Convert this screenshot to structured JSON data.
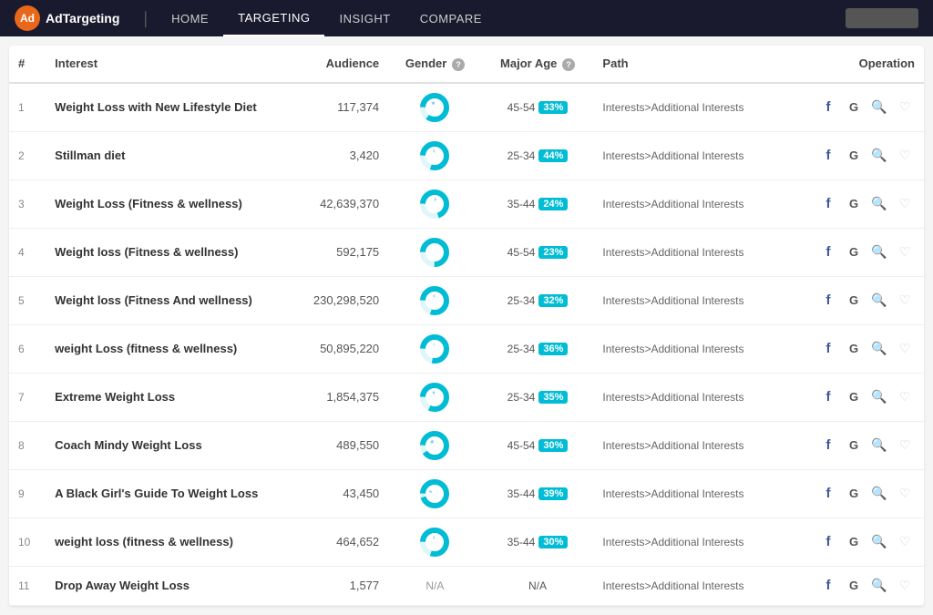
{
  "nav": {
    "logo_icon": "Ad",
    "logo_text": "AdTargeting",
    "links": [
      {
        "label": "HOME",
        "active": false
      },
      {
        "label": "TARGETING",
        "active": true
      },
      {
        "label": "INSIGHT",
        "active": false
      },
      {
        "label": "COMPARE",
        "active": false
      }
    ]
  },
  "table": {
    "columns": [
      {
        "label": "#",
        "key": "num"
      },
      {
        "label": "Interest",
        "key": "interest"
      },
      {
        "label": "Audience",
        "key": "audience"
      },
      {
        "label": "Gender",
        "key": "gender",
        "info": true
      },
      {
        "label": "Major Age",
        "key": "major_age",
        "info": true
      },
      {
        "label": "Path",
        "key": "path"
      },
      {
        "label": "Operation",
        "key": "operation"
      }
    ],
    "rows": [
      {
        "num": 1,
        "interest": "Weight Loss with New Lifestyle Diet",
        "audience": "117,374",
        "gender_male": 15,
        "gender_female": 85,
        "age_range": "45-54",
        "age_pct": "33%",
        "path": "Interests>Additional Interests"
      },
      {
        "num": 2,
        "interest": "Stillman diet",
        "audience": "3,420",
        "gender_male": 20,
        "gender_female": 80,
        "age_range": "25-34",
        "age_pct": "44%",
        "path": "Interests>Additional Interests"
      },
      {
        "num": 3,
        "interest": "Weight Loss (Fitness & wellness)",
        "audience": "42,639,370",
        "gender_male": 30,
        "gender_female": 70,
        "age_range": "35-44",
        "age_pct": "24%",
        "path": "Interests>Additional Interests"
      },
      {
        "num": 4,
        "interest": "Weight loss (Fitness & wellness)",
        "audience": "592,175",
        "gender_male": 25,
        "gender_female": 75,
        "age_range": "45-54",
        "age_pct": "23%",
        "path": "Interests>Additional Interests"
      },
      {
        "num": 5,
        "interest": "Weight loss (Fitness And wellness)",
        "audience": "230,298,520",
        "gender_male": 20,
        "gender_female": 80,
        "age_range": "25-34",
        "age_pct": "32%",
        "path": "Interests>Additional Interests"
      },
      {
        "num": 6,
        "interest": "weight Loss (fitness & wellness)",
        "audience": "50,895,220",
        "gender_male": 22,
        "gender_female": 78,
        "age_range": "25-34",
        "age_pct": "36%",
        "path": "Interests>Additional Interests"
      },
      {
        "num": 7,
        "interest": "Extreme Weight Loss",
        "audience": "1,854,375",
        "gender_male": 18,
        "gender_female": 82,
        "age_range": "25-34",
        "age_pct": "35%",
        "path": "Interests>Additional Interests"
      },
      {
        "num": 8,
        "interest": "Coach Mindy Weight Loss",
        "audience": "489,550",
        "gender_male": 10,
        "gender_female": 90,
        "age_range": "45-54",
        "age_pct": "30%",
        "path": "Interests>Additional Interests"
      },
      {
        "num": 9,
        "interest": "A Black Girl's Guide To Weight Loss",
        "audience": "43,450",
        "gender_male": 5,
        "gender_female": 95,
        "age_range": "35-44",
        "age_pct": "39%",
        "path": "Interests>Additional Interests"
      },
      {
        "num": 10,
        "interest": "weight loss (fitness & wellness)",
        "audience": "464,652",
        "gender_male": 20,
        "gender_female": 80,
        "age_range": "35-44",
        "age_pct": "30%",
        "path": "Interests>Additional Interests"
      },
      {
        "num": 11,
        "interest": "Drop Away Weight Loss",
        "audience": "1,577",
        "gender_male": null,
        "gender_female": null,
        "age_range": "N/A",
        "age_pct": null,
        "path": "Interests>Additional Interests"
      }
    ]
  }
}
